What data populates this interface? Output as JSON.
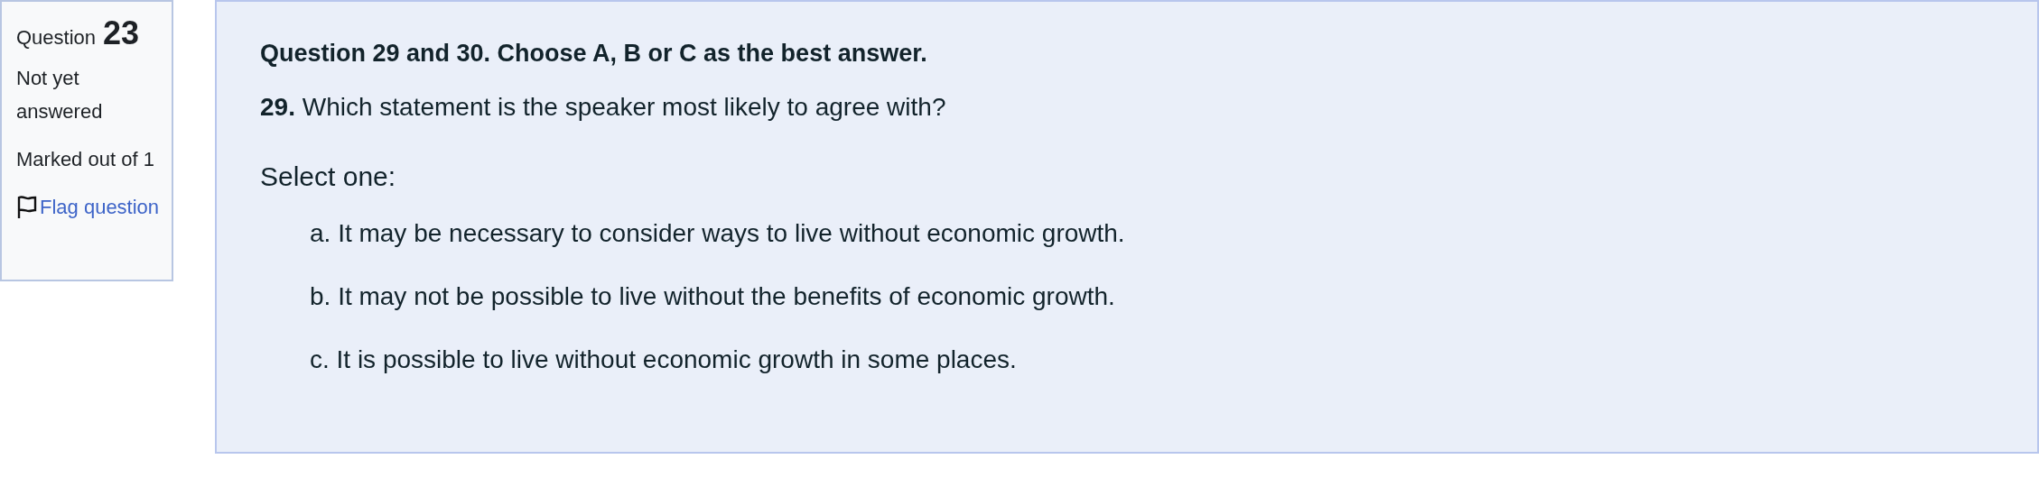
{
  "info": {
    "label": "Question",
    "number": "23",
    "status": "Not yet answered",
    "marks": "Marked out of 1",
    "flag": "Flag question"
  },
  "question": {
    "heading": "Question 29 and 30. Choose A, B or C as the best answer.",
    "prompt": "**29.** Which statement is the speaker most likely to agree with?",
    "instruction": "Select one:",
    "options": [
      {
        "text": "a. It may be necessary to consider ways to live without economic growth."
      },
      {
        "text": "b. It may not be possible to live without the benefits of economic growth."
      },
      {
        "text": "c. It is possible to live without economic growth in some places."
      }
    ]
  }
}
